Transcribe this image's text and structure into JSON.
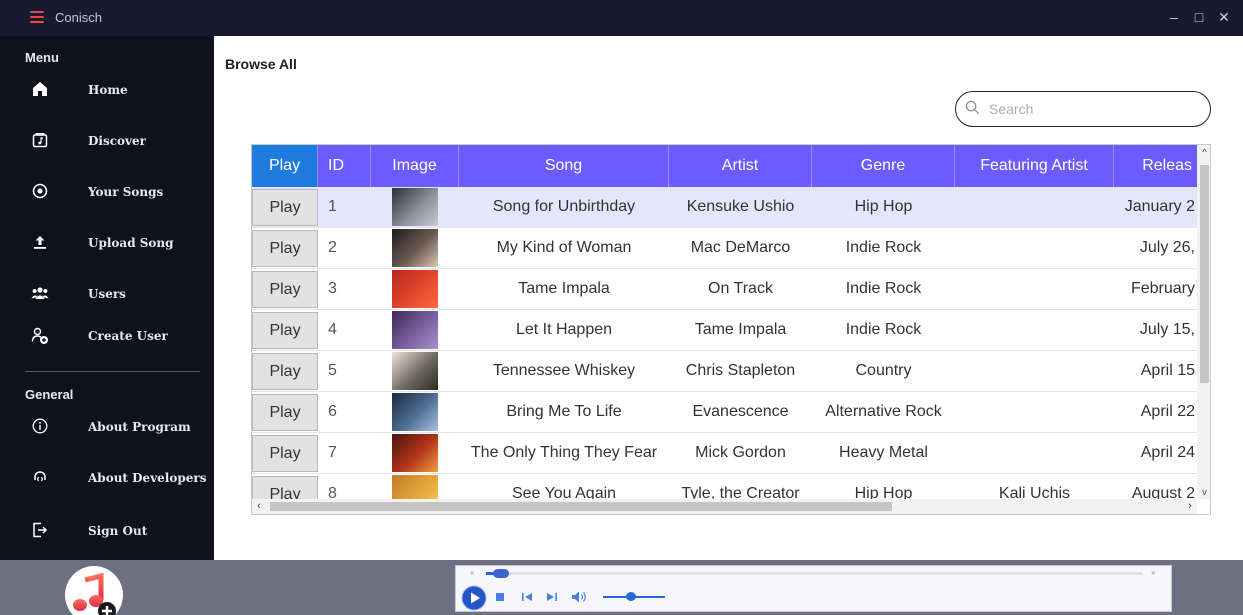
{
  "window": {
    "title": "Conisch",
    "minimize_label": "–",
    "maximize_label": "□",
    "close_label": "✕"
  },
  "sidebar": {
    "menu_title": "Menu",
    "general_title": "General",
    "items": [
      {
        "label": "Home",
        "icon": "home-icon"
      },
      {
        "label": "Discover",
        "icon": "music-note-box-icon"
      },
      {
        "label": "Your Songs",
        "icon": "record-icon"
      },
      {
        "label": "Upload Song",
        "icon": "upload-icon"
      },
      {
        "label": "Users",
        "icon": "users-icon"
      },
      {
        "label": "Create User",
        "icon": "add-user-icon"
      },
      {
        "label": "About Program",
        "icon": "info-icon"
      },
      {
        "label": "About Developers",
        "icon": "developers-icon"
      },
      {
        "label": "Sign Out",
        "icon": "sign-out-icon"
      }
    ]
  },
  "main": {
    "title": "Browse All",
    "search_placeholder": "Search",
    "table": {
      "columns": [
        "Play",
        "ID",
        "Image",
        "Song",
        "Artist",
        "Genre",
        "Featuring Artist",
        "Releas"
      ],
      "play_label": "Play",
      "rows": [
        {
          "id": "1",
          "song": "Song for Unbirthday",
          "artist": "Kensuke Ushio",
          "genre": "Hip Hop",
          "featuring": "",
          "release": "January 2"
        },
        {
          "id": "2",
          "song": "My Kind of Woman",
          "artist": "Mac DeMarco",
          "genre": "Indie Rock",
          "featuring": "",
          "release": "July 26,"
        },
        {
          "id": "3",
          "song": "Tame Impala",
          "artist": "On Track",
          "genre": "Indie Rock",
          "featuring": "",
          "release": "February"
        },
        {
          "id": "4",
          "song": "Let It Happen",
          "artist": "Tame Impala",
          "genre": "Indie Rock",
          "featuring": "",
          "release": "July 15,"
        },
        {
          "id": "5",
          "song": "Tennessee Whiskey",
          "artist": "Chris Stapleton",
          "genre": "Country",
          "featuring": "",
          "release": "April 15"
        },
        {
          "id": "6",
          "song": "Bring Me To Life",
          "artist": "Evanescence",
          "genre": "Alternative Rock",
          "featuring": "",
          "release": "April 22"
        },
        {
          "id": "7",
          "song": "The Only Thing They Fear",
          "artist": "Mick Gordon",
          "genre": "Heavy Metal",
          "featuring": "",
          "release": "April 24"
        },
        {
          "id": "8",
          "song": "See You Again",
          "artist": "Tyle, the Creator",
          "genre": "Hip Hop",
          "featuring": "Kali Uchis",
          "release": "August 2"
        }
      ]
    }
  },
  "player": {
    "progress": 0.01,
    "volume": 0.45
  }
}
